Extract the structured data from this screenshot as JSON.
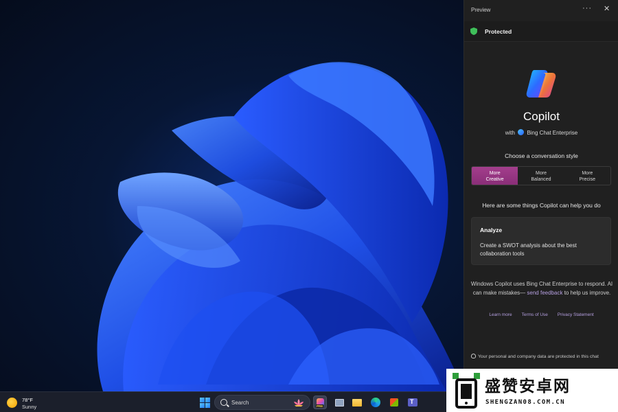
{
  "panel": {
    "header_title": "Preview",
    "more_glyph": "···",
    "close_glyph": "✕",
    "protected_label": "Protected",
    "app_name": "Copilot",
    "subtitle_prefix": "with",
    "subtitle_service": "Bing Chat Enterprise",
    "style_prompt": "Choose a conversation style",
    "styles": [
      {
        "label": "More\nCreative",
        "active": true
      },
      {
        "label": "More\nBalanced",
        "active": false
      },
      {
        "label": "More\nPrecise",
        "active": false
      }
    ],
    "help_prompt": "Here are some things Copilot can help you do",
    "card": {
      "title": "Analyze",
      "text": "Create a SWOT analysis about the best collaboration tools"
    },
    "disclaimer_text": "Windows Copilot uses Bing Chat Enterprise to respond. AI can make mistakes—",
    "disclaimer_link": "send feedback",
    "disclaimer_tail": "to help us improve.",
    "footer_links": [
      "Learn more",
      "Terms of Use",
      "Privacy Statement"
    ],
    "privacy_note": "Your personal and company data are protected in this chat"
  },
  "taskbar": {
    "weather_temp": "78°F",
    "weather_condition": "Sunny",
    "search_placeholder": "Search",
    "copilot_badge": "PRE",
    "teams_letter": "T"
  },
  "watermark": {
    "chinese": "盛赞安卓网",
    "domain": "SHENGZAN08.COM.CN"
  },
  "colors": {
    "accent_creative": "#9b3785",
    "link": "#b59fe0",
    "shield_green": "#3fbf5a"
  }
}
